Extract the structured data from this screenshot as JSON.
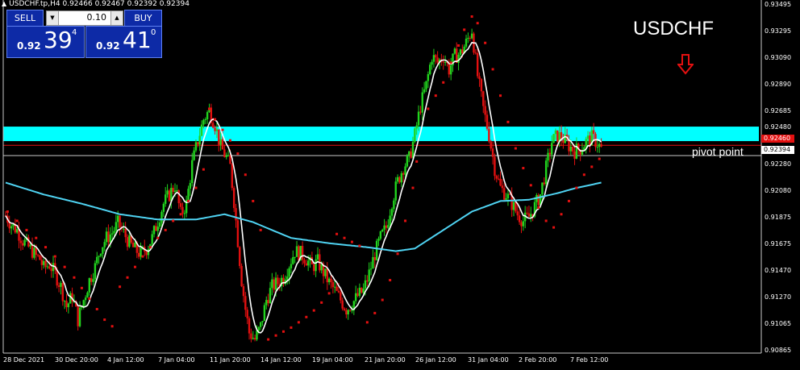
{
  "header": {
    "text": "USDCHF.tp,H4  0.92466 0.92467 0.92392 0.92394"
  },
  "trade_panel": {
    "sell_label": "SELL",
    "buy_label": "BUY",
    "lot": "0.10",
    "sell_price": {
      "prefix": "0.92",
      "big": "39",
      "sup": "4"
    },
    "buy_price": {
      "prefix": "0.92",
      "big": "41",
      "sup": "0"
    }
  },
  "annotations": {
    "symbol": "USDCHF",
    "pivot": "pivot point"
  },
  "price_tags": {
    "red": "0.92460",
    "white": "0.92394"
  },
  "price_axis": [
    "0.93495",
    "0.93295",
    "0.93090",
    "0.92890",
    "0.92685",
    "0.92480",
    "0.92280",
    "0.92080",
    "0.91875",
    "0.91675",
    "0.91470",
    "0.91270",
    "0.91065",
    "0.90865"
  ],
  "time_axis": [
    "28 Dec 2021",
    "30 Dec 20:00",
    "4 Jan 12:00",
    "7 Jan 04:00",
    "11 Jan 20:00",
    "14 Jan 12:00",
    "19 Jan 04:00",
    "21 Jan 20:00",
    "26 Jan 12:00",
    "31 Jan 04:00",
    "2 Feb 20:00",
    "7 Feb 12:00"
  ],
  "colors": {
    "background": "#000000",
    "bull": "#21d41e",
    "bear": "#e31010",
    "zone": "#00ffff",
    "ma_slow": "#4fd3f2",
    "ma_fast": "#ffffff",
    "sar": "#e31010",
    "panel": "#0d2aa6"
  },
  "icons": {
    "down_arrow": "hollow-down-arrow-icon",
    "triangle": "collapse-triangle-icon"
  },
  "chart_data": {
    "type": "candlestick",
    "symbol": "USDCHF",
    "timeframe": "H4",
    "ylim": [
      0.9085,
      0.935
    ],
    "zone": [
      0.92455,
      0.92565
    ],
    "pivot_level": 0.92394,
    "current_price": 0.9246,
    "path": [
      [
        0,
        0.9189
      ],
      [
        3,
        0.9182
      ],
      [
        6,
        0.9178
      ],
      [
        9,
        0.917
      ],
      [
        12,
        0.9165
      ],
      [
        14,
        0.9162
      ],
      [
        16,
        0.9158
      ],
      [
        18,
        0.9156
      ],
      [
        20,
        0.9149
      ],
      [
        23,
        0.9152
      ],
      [
        26,
        0.9145
      ],
      [
        29,
        0.9135
      ],
      [
        32,
        0.912
      ],
      [
        35,
        0.9128
      ],
      [
        38,
        0.911
      ],
      [
        41,
        0.9125
      ],
      [
        44,
        0.914
      ],
      [
        47,
        0.915
      ],
      [
        50,
        0.9165
      ],
      [
        53,
        0.9172
      ],
      [
        56,
        0.9176
      ],
      [
        59,
        0.9183
      ],
      [
        62,
        0.9176
      ],
      [
        65,
        0.9168
      ],
      [
        68,
        0.9163
      ],
      [
        71,
        0.916
      ],
      [
        74,
        0.9164
      ],
      [
        77,
        0.9172
      ],
      [
        80,
        0.9185
      ],
      [
        83,
        0.9198
      ],
      [
        86,
        0.9205
      ],
      [
        89,
        0.9212
      ],
      [
        92,
        0.919
      ],
      [
        95,
        0.9198
      ],
      [
        98,
        0.9228
      ],
      [
        101,
        0.9246
      ],
      [
        104,
        0.9262
      ],
      [
        107,
        0.9269
      ],
      [
        110,
        0.9258
      ],
      [
        113,
        0.9241
      ],
      [
        116,
        0.9233
      ],
      [
        118,
        0.9226
      ],
      [
        120,
        0.92
      ],
      [
        122,
        0.917
      ],
      [
        124,
        0.914
      ],
      [
        126,
        0.9118
      ],
      [
        128,
        0.91
      ],
      [
        131,
        0.9095
      ],
      [
        134,
        0.9105
      ],
      [
        137,
        0.9125
      ],
      [
        140,
        0.9135
      ],
      [
        143,
        0.9138
      ],
      [
        146,
        0.9142
      ],
      [
        149,
        0.9152
      ],
      [
        152,
        0.9162
      ],
      [
        155,
        0.916
      ],
      [
        158,
        0.9156
      ],
      [
        161,
        0.915
      ],
      [
        164,
        0.9154
      ],
      [
        167,
        0.9146
      ],
      [
        170,
        0.9138
      ],
      [
        173,
        0.9132
      ],
      [
        176,
        0.9125
      ],
      [
        179,
        0.9118
      ],
      [
        182,
        0.9122
      ],
      [
        185,
        0.9128
      ],
      [
        188,
        0.9132
      ],
      [
        191,
        0.9145
      ],
      [
        194,
        0.916
      ],
      [
        197,
        0.9172
      ],
      [
        200,
        0.918
      ],
      [
        203,
        0.92
      ],
      [
        206,
        0.9215
      ],
      [
        209,
        0.9226
      ],
      [
        212,
        0.9232
      ],
      [
        215,
        0.925
      ],
      [
        218,
        0.9272
      ],
      [
        221,
        0.9288
      ],
      [
        224,
        0.931
      ],
      [
        227,
        0.9305
      ],
      [
        230,
        0.931
      ],
      [
        233,
        0.93
      ],
      [
        236,
        0.931
      ],
      [
        239,
        0.9312
      ],
      [
        242,
        0.932
      ],
      [
        245,
        0.933
      ],
      [
        248,
        0.9295
      ],
      [
        251,
        0.927
      ],
      [
        254,
        0.925
      ],
      [
        257,
        0.9225
      ],
      [
        260,
        0.921
      ],
      [
        263,
        0.9205
      ],
      [
        266,
        0.9198
      ],
      [
        269,
        0.919
      ],
      [
        272,
        0.9185
      ],
      [
        275,
        0.9188
      ],
      [
        278,
        0.9196
      ],
      [
        281,
        0.9205
      ],
      [
        284,
        0.9225
      ],
      [
        287,
        0.9245
      ],
      [
        290,
        0.925
      ],
      [
        293,
        0.9247
      ],
      [
        296,
        0.9242
      ],
      [
        299,
        0.9238
      ],
      [
        302,
        0.924
      ],
      [
        305,
        0.9245
      ],
      [
        308,
        0.9248
      ],
      [
        311,
        0.9244
      ],
      [
        313,
        0.92394
      ]
    ],
    "ma_slow": [
      [
        0,
        0.9214
      ],
      [
        20,
        0.9205
      ],
      [
        40,
        0.9198
      ],
      [
        60,
        0.919
      ],
      [
        80,
        0.9186
      ],
      [
        100,
        0.9186
      ],
      [
        115,
        0.919
      ],
      [
        130,
        0.9184
      ],
      [
        150,
        0.9172
      ],
      [
        170,
        0.9168
      ],
      [
        190,
        0.9165
      ],
      [
        205,
        0.9162
      ],
      [
        215,
        0.9164
      ],
      [
        230,
        0.9178
      ],
      [
        245,
        0.9192
      ],
      [
        260,
        0.92
      ],
      [
        275,
        0.9201
      ],
      [
        290,
        0.9206
      ],
      [
        300,
        0.921
      ],
      [
        313,
        0.9214
      ]
    ],
    "sar": [
      [
        1,
        0.9192
      ],
      [
        6,
        0.9185
      ],
      [
        11,
        0.9178
      ],
      [
        16,
        0.9172
      ],
      [
        21,
        0.9165
      ],
      [
        26,
        0.9158
      ],
      [
        31,
        0.915
      ],
      [
        36,
        0.9142
      ],
      [
        40,
        0.9134
      ],
      [
        44,
        0.9126
      ],
      [
        48,
        0.9118
      ],
      [
        52,
        0.911
      ],
      [
        56,
        0.9105
      ],
      [
        60,
        0.9135
      ],
      [
        64,
        0.9142
      ],
      [
        68,
        0.915
      ],
      [
        72,
        0.9158
      ],
      [
        76,
        0.9165
      ],
      [
        80,
        0.9172
      ],
      [
        84,
        0.9178
      ],
      [
        88,
        0.9185
      ],
      [
        92,
        0.919
      ],
      [
        96,
        0.92
      ],
      [
        100,
        0.921
      ],
      [
        104,
        0.9224
      ],
      [
        107,
        0.927
      ],
      [
        110,
        0.9262
      ],
      [
        114,
        0.9254
      ],
      [
        118,
        0.9246
      ],
      [
        122,
        0.9236
      ],
      [
        126,
        0.922
      ],
      [
        130,
        0.92
      ],
      [
        134,
        0.9178
      ],
      [
        138,
        0.9095
      ],
      [
        142,
        0.9098
      ],
      [
        146,
        0.9101
      ],
      [
        150,
        0.9104
      ],
      [
        154,
        0.9108
      ],
      [
        158,
        0.9112
      ],
      [
        162,
        0.9117
      ],
      [
        166,
        0.9123
      ],
      [
        170,
        0.913
      ],
      [
        174,
        0.9175
      ],
      [
        178,
        0.9172
      ],
      [
        182,
        0.9169
      ],
      [
        186,
        0.9166
      ],
      [
        190,
        0.9108
      ],
      [
        194,
        0.9115
      ],
      [
        198,
        0.9125
      ],
      [
        202,
        0.914
      ],
      [
        206,
        0.916
      ],
      [
        210,
        0.9185
      ],
      [
        214,
        0.921
      ],
      [
        216,
        0.923
      ],
      [
        222,
        0.927
      ],
      [
        226,
        0.928
      ],
      [
        230,
        0.929
      ],
      [
        234,
        0.9305
      ],
      [
        238,
        0.9318
      ],
      [
        241,
        0.933
      ],
      [
        245,
        0.934
      ],
      [
        248,
        0.9335
      ],
      [
        252,
        0.932
      ],
      [
        256,
        0.93
      ],
      [
        260,
        0.928
      ],
      [
        264,
        0.926
      ],
      [
        268,
        0.924
      ],
      [
        272,
        0.9225
      ],
      [
        276,
        0.9212
      ],
      [
        280,
        0.9195
      ],
      [
        284,
        0.9185
      ],
      [
        288,
        0.918
      ],
      [
        292,
        0.919
      ],
      [
        296,
        0.92
      ],
      [
        300,
        0.921
      ],
      [
        304,
        0.922
      ],
      [
        308,
        0.9226
      ],
      [
        312,
        0.9232
      ]
    ]
  }
}
